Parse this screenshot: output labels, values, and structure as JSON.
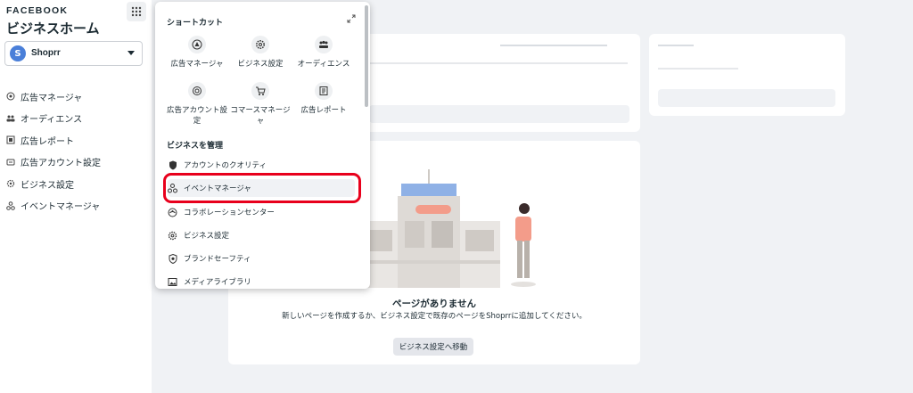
{
  "sidebar": {
    "brand": "FACEBOOK",
    "title": "ビジネスホーム",
    "account": {
      "initial": "S",
      "name": "Shoprr"
    },
    "items": [
      {
        "label": "広告マネージャ",
        "icon": "target-icon"
      },
      {
        "label": "オーディエンス",
        "icon": "people-icon"
      },
      {
        "label": "広告レポート",
        "icon": "report-icon"
      },
      {
        "label": "広告アカウント設定",
        "icon": "ad-account-icon"
      },
      {
        "label": "ビジネス設定",
        "icon": "gear-icon"
      },
      {
        "label": "イベントマネージャ",
        "icon": "events-icon"
      }
    ]
  },
  "dropdown": {
    "shortcuts_title": "ショートカット",
    "shortcuts": [
      {
        "label": "広告マネージャ",
        "icon": "target-icon"
      },
      {
        "label": "ビジネス設定",
        "icon": "gear-icon"
      },
      {
        "label": "オーディエンス",
        "icon": "people-icon"
      },
      {
        "label": "広告アカウント設定",
        "icon": "ad-account-icon"
      },
      {
        "label": "コマースマネージャ",
        "icon": "cart-icon"
      },
      {
        "label": "広告レポート",
        "icon": "report-icon"
      }
    ],
    "manage_title": "ビジネスを管理",
    "manage": [
      {
        "label": "アカウントのクオリティ",
        "icon": "shield-icon"
      },
      {
        "label": "イベントマネージャ",
        "icon": "events-icon"
      },
      {
        "label": "コラボレーションセンター",
        "icon": "collab-icon"
      },
      {
        "label": "ビジネス設定",
        "icon": "gear-icon"
      },
      {
        "label": "ブランドセーフティ",
        "icon": "brand-shield-icon"
      },
      {
        "label": "メディアライブラリ",
        "icon": "media-icon"
      }
    ]
  },
  "main": {
    "empty_title": "ページがありません",
    "empty_desc": "新しいページを作成するか、ビジネス設定で既存のページをShoprrに追加してください。",
    "goto_button": "ビジネス設定へ移動"
  },
  "colors": {
    "highlight": "#e8001c",
    "avatar": "#4a7fd9",
    "background": "#f0f2f5"
  }
}
